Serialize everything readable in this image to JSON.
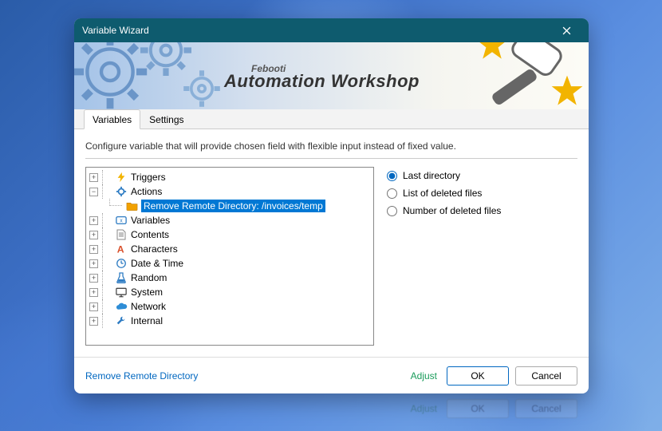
{
  "window": {
    "title": "Variable Wizard"
  },
  "banner": {
    "brand_small": "Febooti",
    "brand_big": "Automation Workshop"
  },
  "tabs": [
    {
      "label": "Variables",
      "active": true
    },
    {
      "label": "Settings",
      "active": false
    }
  ],
  "description": "Configure variable that will provide chosen field with flexible input instead of fixed value.",
  "tree": [
    {
      "label": "Triggers",
      "icon": "bolt",
      "color": "#f2b400",
      "expander": "+"
    },
    {
      "label": "Actions",
      "icon": "gear",
      "color": "#2e7cc3",
      "expander": "−",
      "children": [
        {
          "label": "Remove Remote Directory: /invoices/temp",
          "icon": "folder",
          "color": "#f2a100",
          "selected": true
        }
      ]
    },
    {
      "label": "Variables",
      "icon": "var",
      "color": "#2e7cc3",
      "expander": "+"
    },
    {
      "label": "Contents",
      "icon": "doc",
      "color": "#888",
      "expander": "+"
    },
    {
      "label": "Characters",
      "icon": "char",
      "color": "#d94f2a",
      "expander": "+"
    },
    {
      "label": "Date & Time",
      "icon": "clock",
      "color": "#2e7cc3",
      "expander": "+"
    },
    {
      "label": "Random",
      "icon": "flask",
      "color": "#2e7cc3",
      "expander": "+"
    },
    {
      "label": "System",
      "icon": "monitor",
      "color": "#333",
      "expander": "+"
    },
    {
      "label": "Network",
      "icon": "cloud",
      "color": "#2e8dd6",
      "expander": "+"
    },
    {
      "label": "Internal",
      "icon": "wrench",
      "color": "#2e7cc3",
      "expander": "+"
    }
  ],
  "radios": [
    {
      "label": "Last directory",
      "checked": true
    },
    {
      "label": "List of deleted files",
      "checked": false
    },
    {
      "label": "Number of deleted files",
      "checked": false
    }
  ],
  "footer": {
    "link": "Remove Remote Directory",
    "adjust": "Adjust",
    "ok": "OK",
    "cancel": "Cancel"
  }
}
